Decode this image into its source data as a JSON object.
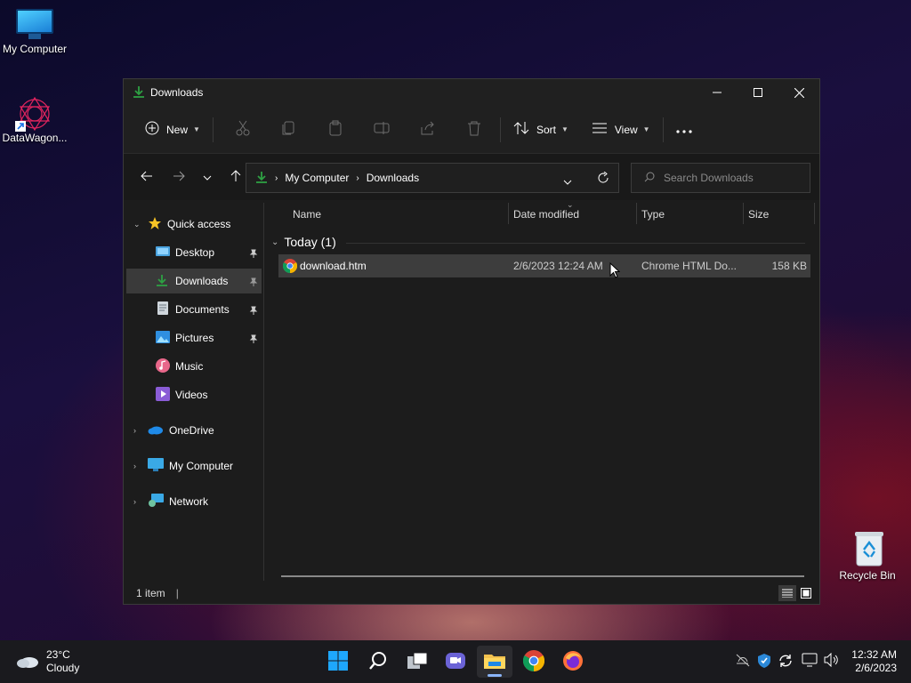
{
  "desktop": {
    "icons": [
      {
        "label": "My Computer"
      },
      {
        "label": "DataWagon..."
      },
      {
        "label": "Recycle Bin"
      }
    ]
  },
  "window": {
    "title": "Downloads",
    "toolbar": {
      "new_label": "New",
      "sort_label": "Sort",
      "view_label": "View"
    },
    "address": {
      "crumbs": [
        "My Computer",
        "Downloads"
      ]
    },
    "search": {
      "placeholder": "Search Downloads"
    },
    "sidebar": {
      "quick_access": "Quick access",
      "items": [
        {
          "label": "Desktop",
          "pinned": true
        },
        {
          "label": "Downloads",
          "pinned": true,
          "selected": true
        },
        {
          "label": "Documents",
          "pinned": true
        },
        {
          "label": "Pictures",
          "pinned": true
        },
        {
          "label": "Music"
        },
        {
          "label": "Videos"
        }
      ],
      "roots": [
        {
          "label": "OneDrive"
        },
        {
          "label": "My Computer"
        },
        {
          "label": "Network"
        }
      ]
    },
    "columns": {
      "name": "Name",
      "date": "Date modified",
      "type": "Type",
      "size": "Size"
    },
    "group": {
      "label": "Today (1)"
    },
    "files": [
      {
        "name": "download.htm",
        "date": "2/6/2023 12:24 AM",
        "type": "Chrome HTML Do...",
        "size": "158 KB"
      }
    ],
    "status": {
      "count": "1 item"
    }
  },
  "taskbar": {
    "weather": {
      "temp": "23°C",
      "cond": "Cloudy"
    },
    "clock": {
      "time": "12:32 AM",
      "date": "2/6/2023"
    }
  },
  "colors": {
    "accent": "#2ea043",
    "selection": "#3d3d3d",
    "taskbar": "#1a1a1e"
  }
}
